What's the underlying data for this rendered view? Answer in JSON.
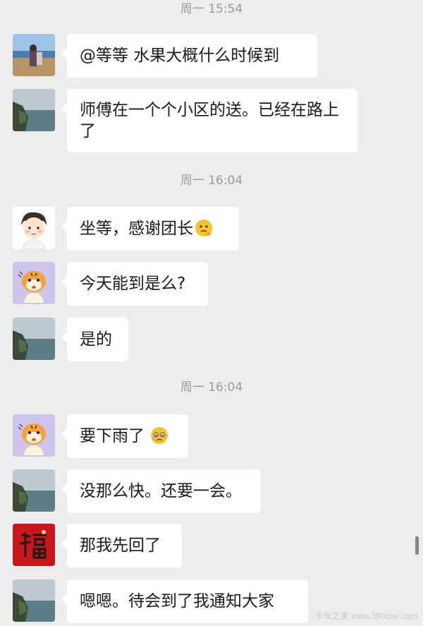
{
  "timestamps": [
    "周一 15:54",
    "周一 16:04",
    "周一 16:04"
  ],
  "messages": [
    {
      "avatar": "beach-photo-avatar",
      "text": "@等等  水果大概什么时候到"
    },
    {
      "avatar": "coast-landscape-avatar",
      "text": "师傅在一个个小区的送。已经在路上了"
    },
    {
      "avatar": "cartoon-boy-avatar",
      "text": "坐等，感谢团长",
      "emoji": "thinking-face-emoji"
    },
    {
      "avatar": "cartoon-tiger-avatar",
      "text": "今天能到是么?"
    },
    {
      "avatar": "coast-landscape-avatar",
      "text": "是的"
    },
    {
      "avatar": "cartoon-tiger-avatar",
      "text": "要下雨了",
      "emoji": "crying-face-emoji"
    },
    {
      "avatar": "coast-landscape-avatar",
      "text": "没那么快。还要一会。"
    },
    {
      "avatar": "red-fu-character-avatar",
      "text": "那我先回了"
    },
    {
      "avatar": "coast-landscape-avatar",
      "text": "嗯嗯。待会到了我通知大家"
    }
  ],
  "watermark": "卡车之家 www.360che.com",
  "colors": {
    "background": "#ededed",
    "bubble": "#ffffff",
    "timestamp": "#9a9a9a",
    "fu_red": "#c8161d"
  }
}
